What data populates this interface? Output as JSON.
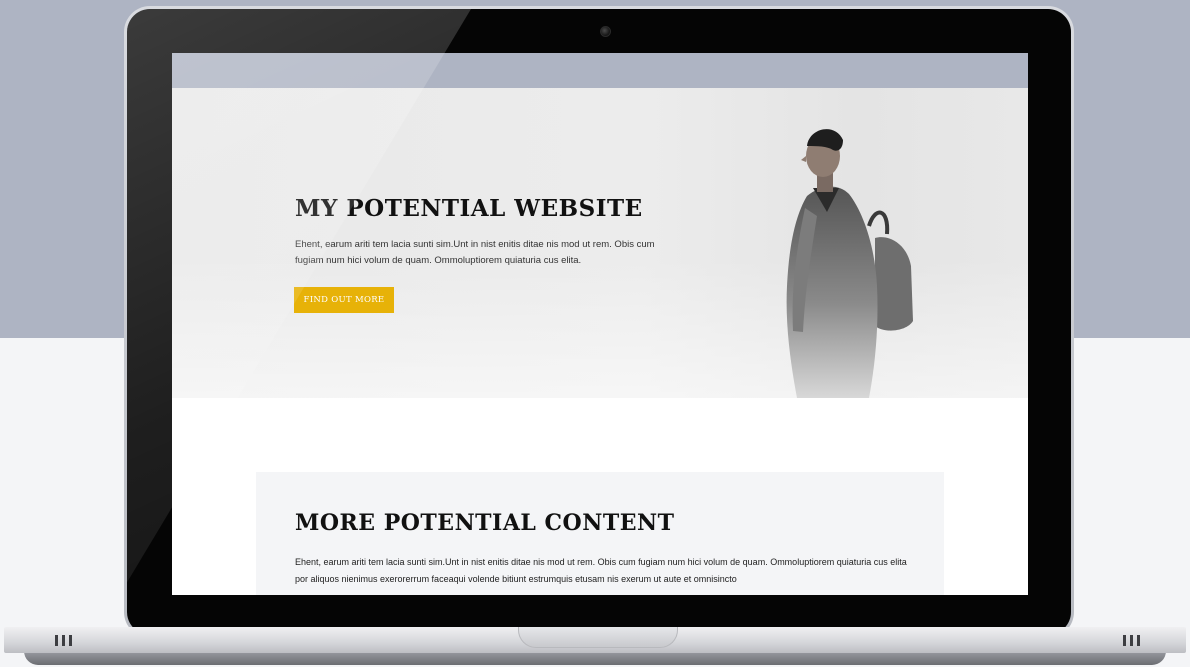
{
  "hero": {
    "title": "MY POTENTIAL WEBSITE",
    "text": "Ehent, earum ariti tem lacia sunti sim.Unt in nist enitis ditae nis mod ut rem. Obis cum fugiam num hici volum de quam. Ommoluptiorem quiaturia cus elita.",
    "button_label": "FIND OUT MORE"
  },
  "content": {
    "title": "MORE POTENTIAL CONTENT",
    "text": "Ehent, earum ariti tem lacia sunti sim.Unt in nist enitis ditae nis mod ut rem. Obis cum fugiam num hici volum de quam. Ommoluptiorem quiaturia cus elita por aliquos nienimus exerorerrum faceaqui volende bitiunt estrumquis etusam nis exerum ut aute et omnisincto"
  },
  "colors": {
    "accent": "#e7b208",
    "backdrop": "#aeb4c3",
    "card": "#f4f5f7"
  },
  "icons": {
    "camera": "camera-icon",
    "vents": "vent-icon"
  }
}
